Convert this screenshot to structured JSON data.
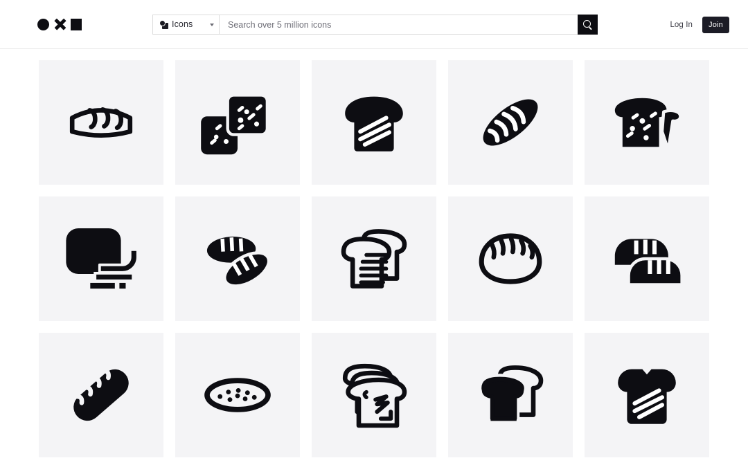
{
  "header": {
    "logo": {
      "name": "brand-logo",
      "shapes": [
        "circle",
        "x",
        "square"
      ],
      "color": "#0d0d12"
    },
    "category_select": {
      "label": "Icons",
      "icon": "icons-category-glyph",
      "chevron": "chevron-down-icon"
    },
    "search": {
      "value": "",
      "placeholder": "Search over 5 million icons",
      "button_icon": "search-icon",
      "button_color": "#0d0d12"
    },
    "auth": {
      "login_label": "Log In",
      "join_label": "Join",
      "join_bg": "#1c1c26"
    }
  },
  "theme": {
    "page_bg": "#ffffff",
    "tile_bg": "#f4f4f6",
    "icon_color": "#0d0d12",
    "border": "#e8e8e8"
  },
  "grid": {
    "columns": 5,
    "rows": 3,
    "tiles": [
      {
        "id": "icon-1",
        "name": "bread-loaf-outline-icon",
        "alt": "Bread loaf outline with three scores"
      },
      {
        "id": "icon-2",
        "name": "two-seeded-bread-slices-solid-icon",
        "alt": "Two overlapping seeded bread slices"
      },
      {
        "id": "icon-3",
        "name": "bread-slice-striped-solid-icon",
        "alt": "Solid bread slice with three stripes"
      },
      {
        "id": "icon-4",
        "name": "baguette-diagonal-solid-icon",
        "alt": "Diagonal baguette with scores"
      },
      {
        "id": "icon-5",
        "name": "bread-slice-with-crust-piece-icon",
        "alt": "Seeded bread slice with torn crust piece"
      },
      {
        "id": "icon-6",
        "name": "bread-stack-rounded-solid-icon",
        "alt": "Rounded bread block with stacked slices"
      },
      {
        "id": "icon-7",
        "name": "two-loaves-solid-icon",
        "alt": "Two oval loaves with scores"
      },
      {
        "id": "icon-8",
        "name": "two-bread-slices-lined-outline-icon",
        "alt": "Two outlined bread slices with lines"
      },
      {
        "id": "icon-9",
        "name": "round-bread-roll-outline-icon",
        "alt": "Round bread roll outline with scores"
      },
      {
        "id": "icon-10",
        "name": "two-loaves-stacked-solid-icon",
        "alt": "Two stacked loaves with scores"
      },
      {
        "id": "icon-11",
        "name": "baguette-thick-diagonal-solid-icon",
        "alt": "Thick diagonal baguette"
      },
      {
        "id": "icon-12",
        "name": "seeded-oval-bread-outline-icon",
        "alt": "Oval bread outline with seeds"
      },
      {
        "id": "icon-13",
        "name": "three-bread-slices-zigzag-icon",
        "alt": "Three stacked slices with zigzag"
      },
      {
        "id": "icon-14",
        "name": "two-bread-slices-filled-icon",
        "alt": "Two slices, front filled"
      },
      {
        "id": "icon-15",
        "name": "bread-slice-striped-solid-alt-icon",
        "alt": "Solid bread slice with three stripes"
      }
    ]
  }
}
